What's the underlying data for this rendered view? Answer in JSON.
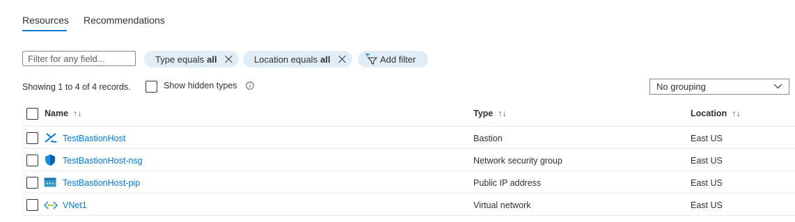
{
  "tabs": [
    {
      "label": "Resources"
    },
    {
      "label": "Recommendations"
    }
  ],
  "filter": {
    "placeholder": "Filter for any field...",
    "pills": [
      {
        "prefix": "Type equals",
        "value": "all"
      },
      {
        "prefix": "Location equals",
        "value": "all"
      }
    ],
    "add_filter_label": "Add filter"
  },
  "records_text": "Showing 1 to 4 of 4 records.",
  "show_hidden_label": "Show hidden types",
  "grouping": {
    "selected": "No grouping"
  },
  "table": {
    "headers": {
      "name": "Name",
      "type": "Type",
      "location": "Location"
    },
    "rows": [
      {
        "name": "TestBastionHost",
        "type": "Bastion",
        "location": "East US",
        "icon": "bastion-icon"
      },
      {
        "name": "TestBastionHost-nsg",
        "type": "Network security group",
        "location": "East US",
        "icon": "shield-icon"
      },
      {
        "name": "TestBastionHost-pip",
        "type": "Public IP address",
        "location": "East US",
        "icon": "public-ip-icon"
      },
      {
        "name": "VNet1",
        "type": "Virtual network",
        "location": "East US",
        "icon": "vnet-icon"
      }
    ]
  },
  "colors": {
    "accent": "#0078d4",
    "pill_bg": "#e1edf7"
  }
}
